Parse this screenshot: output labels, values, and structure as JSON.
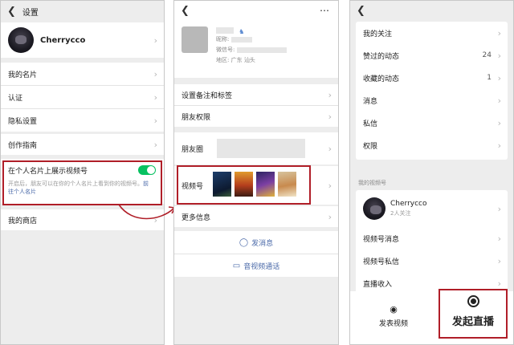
{
  "panel1": {
    "header_title": "设置",
    "profile_name": "Cherrycco",
    "items": [
      "我的名片",
      "认证",
      "隐私设置"
    ],
    "creator_guide": "创作指南",
    "toggle_title": "在个人名片上展示视频号",
    "toggle_desc": "开启后，朋友可以在你的个人名片上看到你的视频号。",
    "toggle_link": "前往个人名片",
    "toggle_on": true,
    "shop": "我的商店"
  },
  "panel2": {
    "nickname_label": "昵称:",
    "wechat_id_label": "微信号:",
    "region_label": "地区:",
    "region_value": "广东  汕头",
    "remark": "设置备注和标签",
    "permissions": "朋友权限",
    "moments": "朋友圈",
    "channels": "视频号",
    "more_info": "更多信息",
    "send_message": "发消息",
    "video_call": "音视频通话"
  },
  "panel3": {
    "items": [
      {
        "label": "我的关注",
        "count": ""
      },
      {
        "label": "赞过的动态",
        "count": "24"
      },
      {
        "label": "收藏的动态",
        "count": "1"
      },
      {
        "label": "消息",
        "count": ""
      },
      {
        "label": "私信",
        "count": ""
      },
      {
        "label": "权限",
        "count": ""
      }
    ],
    "section_title": "我的视频号",
    "channel_name": "Cherrycco",
    "followers": "2人关注",
    "channel_items": [
      "视频号消息",
      "视频号私信",
      "直播收入"
    ],
    "publish_video": "发表视频",
    "start_live": "发起直播"
  },
  "colors": {
    "accent_green": "#07c160",
    "highlight_red": "#b01e28",
    "link_blue": "#4a69a8"
  }
}
